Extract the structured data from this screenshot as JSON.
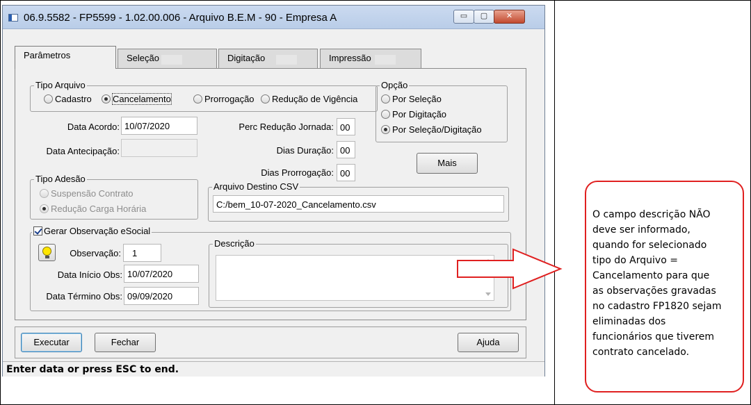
{
  "window": {
    "title": "06.9.5582 - FP5599 - 1.02.00.006 - Arquivo B.E.M - 90 - Empresa A",
    "buttons": {
      "minimize": "▭",
      "maximize": "▢",
      "close": "✕"
    }
  },
  "tabs": [
    {
      "label": "Parâmetros",
      "active": true
    },
    {
      "label": "Seleção",
      "active": false
    },
    {
      "label": "Digitação",
      "active": false
    },
    {
      "label": "Impressão",
      "active": false
    }
  ],
  "tipo_arquivo": {
    "legend": "Tipo Arquivo",
    "options": [
      "Cadastro",
      "Cancelamento",
      "Prorrogação",
      "Redução de Vigência"
    ],
    "selected": "Cancelamento"
  },
  "opcao": {
    "legend": "Opção",
    "options": [
      "Por Seleção",
      "Por Digitação",
      "Por Seleção/Digitação"
    ],
    "selected": "Por Seleção/Digitação"
  },
  "fields": {
    "data_acordo_label": "Data Acordo:",
    "data_acordo_value": "10/07/2020",
    "data_antecipacao_label": "Data Antecipação:",
    "data_antecipacao_value": "",
    "perc_reducao_label": "Perc Redução Jornada:",
    "perc_reducao_value": "00",
    "dias_duracao_label": "Dias Duração:",
    "dias_duracao_value": "00",
    "dias_prorrogacao_label": "Dias Prorrogação:",
    "dias_prorrogacao_value": "00"
  },
  "mais_button": "Mais",
  "tipo_adesao": {
    "legend": "Tipo Adesão",
    "options": [
      "Suspensão Contrato",
      "Redução Carga Horária"
    ],
    "selected": "Redução Carga Horária",
    "disabled": true
  },
  "arquivo_destino": {
    "legend": "Arquivo Destino CSV",
    "value": "C:/bem_10-07-2020_Cancelamento.csv"
  },
  "esocial": {
    "checkbox_label": "Gerar Observação eSocial",
    "checked": true,
    "observacao_label": "Observação:",
    "observacao_value": "1",
    "data_inicio_label": "Data Início Obs:",
    "data_inicio_value": "10/07/2020",
    "data_termino_label": "Data Término Obs:",
    "data_termino_value": "09/09/2020",
    "descricao_legend": "Descrição",
    "descricao_value": ""
  },
  "actions": {
    "executar": "Executar",
    "fechar": "Fechar",
    "ajuda": "Ajuda"
  },
  "status_bar": "Enter data or press ESC to end.",
  "annotation": {
    "lines": [
      "O campo descrição NÃO",
      "deve ser informado,",
      "quando for selecionado",
      "tipo do Arquivo =",
      "Cancelamento  para que",
      "as observações  gravadas",
      "no cadastro FP1820 sejam",
      "eliminadas dos",
      "funcionários que tiverem",
      "contrato cancelado."
    ],
    "border_color": "#e02020"
  },
  "colors": {
    "window_bg": "#f0f0f0",
    "titlebar": "#c4d6ee",
    "annotation_red": "#e02020"
  }
}
